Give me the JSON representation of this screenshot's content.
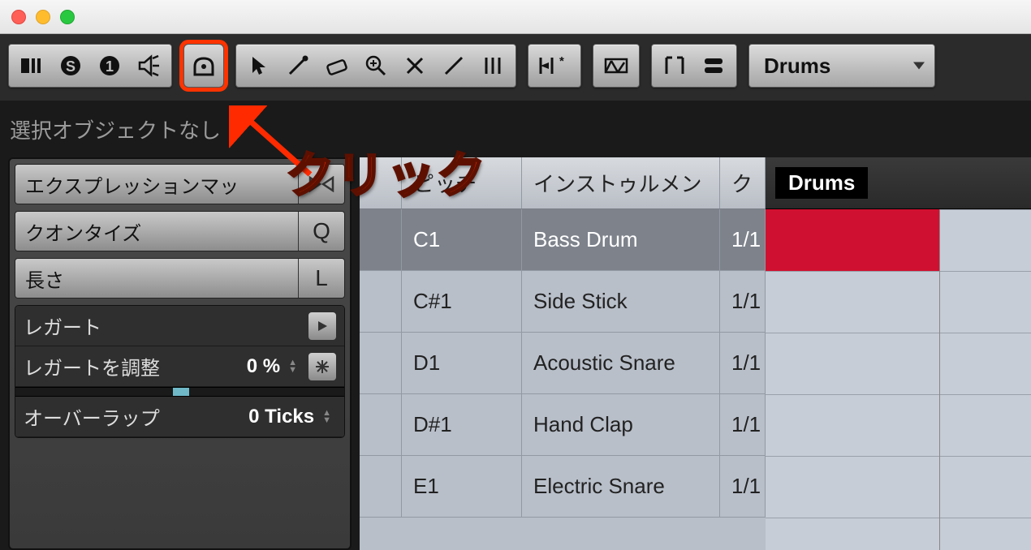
{
  "annotation": {
    "label": "クリック"
  },
  "info_bar": {
    "text": "選択オブジェクトなし"
  },
  "track_dropdown": {
    "value": "Drums"
  },
  "timeline": {
    "part_name": "Drums"
  },
  "inspector": {
    "items": [
      {
        "label": "エクスプレッションマッ",
        "cap_icon": "bowtie"
      },
      {
        "label": "クオンタイズ",
        "cap_text": "Q"
      },
      {
        "label": "長さ",
        "cap_text": "L"
      }
    ],
    "dark": {
      "legato_label": "レガート",
      "legato_adjust_label": "レガートを調整",
      "legato_adjust_value": "0 %",
      "overlap_label": "オーバーラップ",
      "overlap_value": "0 Ticks"
    }
  },
  "drum_table": {
    "headers": {
      "pitch": "ピッチ",
      "instrument": "インストゥルメン",
      "q": "ク"
    },
    "rows": [
      {
        "pitch": "C1",
        "instrument": "Bass Drum",
        "q": "1/1",
        "selected": true
      },
      {
        "pitch": "C#1",
        "instrument": "Side Stick",
        "q": "1/1",
        "selected": false
      },
      {
        "pitch": "D1",
        "instrument": "Acoustic Snare",
        "q": "1/1",
        "selected": false
      },
      {
        "pitch": "D#1",
        "instrument": "Hand Clap",
        "q": "1/1",
        "selected": false
      },
      {
        "pitch": "E1",
        "instrument": "Electric Snare",
        "q": "1/1",
        "selected": false
      }
    ]
  }
}
